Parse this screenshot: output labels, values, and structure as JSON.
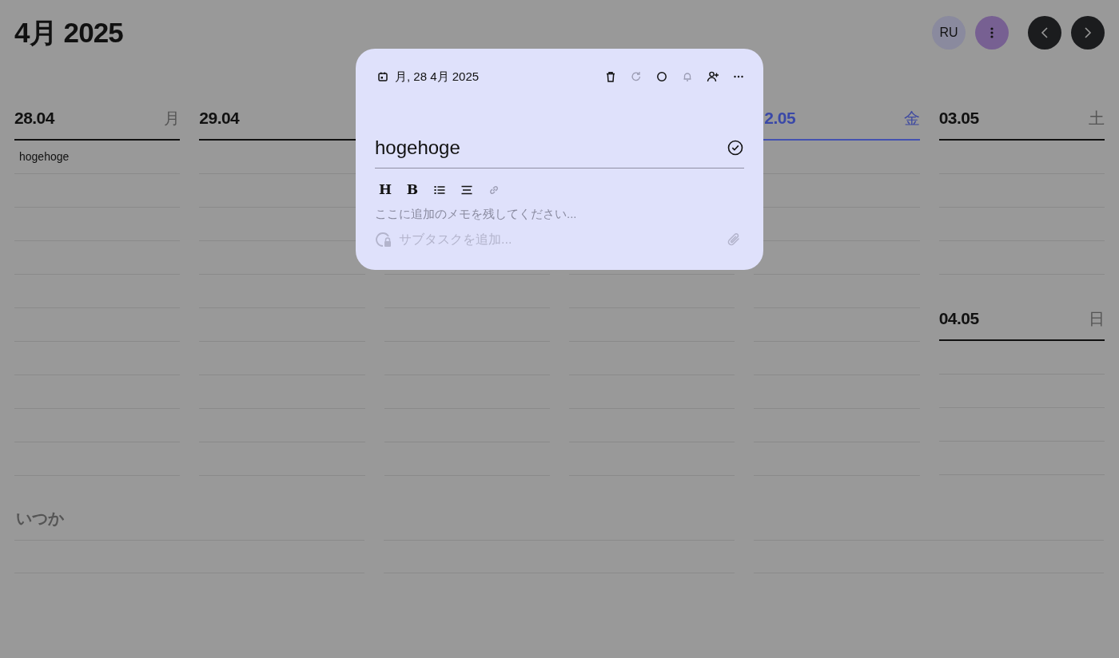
{
  "header": {
    "title": "4月 2025",
    "avatar": "RU"
  },
  "days": [
    {
      "date": "28.04",
      "weekday": "月",
      "today": false,
      "tasks": [
        "hogehoge"
      ]
    },
    {
      "date": "29.04",
      "today": false
    },
    {
      "date": "2.05",
      "weekday": "金",
      "today": true
    },
    {
      "date": "03.05",
      "weekday": "土",
      "today": false
    },
    {
      "date": "04.05",
      "weekday": "日",
      "today": false
    }
  ],
  "someday": {
    "title": "いつか"
  },
  "task_popup": {
    "date": "月, 28 4月 2025",
    "title": "hogehoge",
    "actions": [
      {
        "kind": "delete",
        "disabled": false
      },
      {
        "kind": "redo",
        "disabled": true
      },
      {
        "kind": "circle",
        "disabled": false
      },
      {
        "kind": "bell",
        "disabled": true
      },
      {
        "kind": "add-person",
        "disabled": false
      },
      {
        "kind": "more",
        "disabled": false
      }
    ],
    "format_buttons": [
      {
        "kind": "text",
        "label": "H"
      },
      {
        "kind": "text",
        "label": "B"
      },
      {
        "kind": "bullet-list",
        "disabled": false
      },
      {
        "kind": "align",
        "disabled": false
      },
      {
        "kind": "link",
        "disabled": true
      }
    ],
    "memo_placeholder": "ここに追加のメモを残してください...",
    "subtask_placeholder": "サブタスクを追加..."
  }
}
